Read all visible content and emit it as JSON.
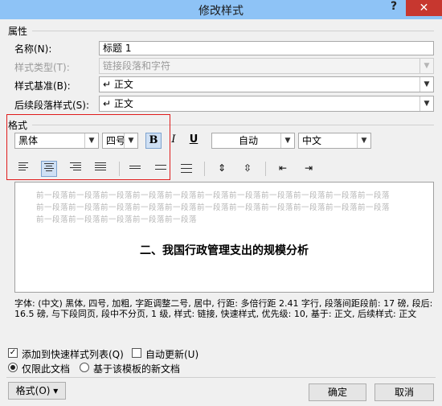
{
  "window": {
    "title": "修改样式",
    "help": "?",
    "close": "✕"
  },
  "properties": {
    "section": "属性",
    "name_label": "名称(N):",
    "name_value": "标题 1",
    "type_label": "样式类型(T):",
    "type_value": "链接段落和字符",
    "based_label": "样式基准(B):",
    "based_value": "↵ 正文",
    "next_label": "后续段落样式(S):",
    "next_value": "↵ 正文"
  },
  "format": {
    "section": "格式",
    "font": "黑体",
    "size": "四号",
    "bold": "B",
    "italic": "I",
    "underline": "U",
    "color": "自动",
    "lang": "中文"
  },
  "preview": {
    "filler1": "前一段落前一段落前一段落前一段落前一段落前一段落前一段落前一段落前一段落前一段落前一段落",
    "filler2": "前一段落前一段落前一段落前一段落前一段落前一段落前一段落前一段落前一段落前一段落前一段落",
    "filler3": "前一段落前一段落前一段落前一段落前一段落",
    "sample": "二、我国行政管理支出的规模分析"
  },
  "description": "字体: (中文) 黑体, 四号, 加粗, 字距调整二号, 居中, 行距: 多倍行距 2.41 字行, 段落间距段前: 17 磅, 段后: 16.5 磅, 与下段同页, 段中不分页, 1 级, 样式: 链接, 快速样式, 优先级: 10, 基于: 正文, 后续样式: 正文",
  "options": {
    "add_quick": "添加到快速样式列表(Q)",
    "auto_update": "自动更新(U)",
    "only_doc": "仅限此文档",
    "template": "基于该模板的新文档"
  },
  "buttons": {
    "format": "格式(O) ▾",
    "ok": "确定",
    "cancel": "取消"
  }
}
